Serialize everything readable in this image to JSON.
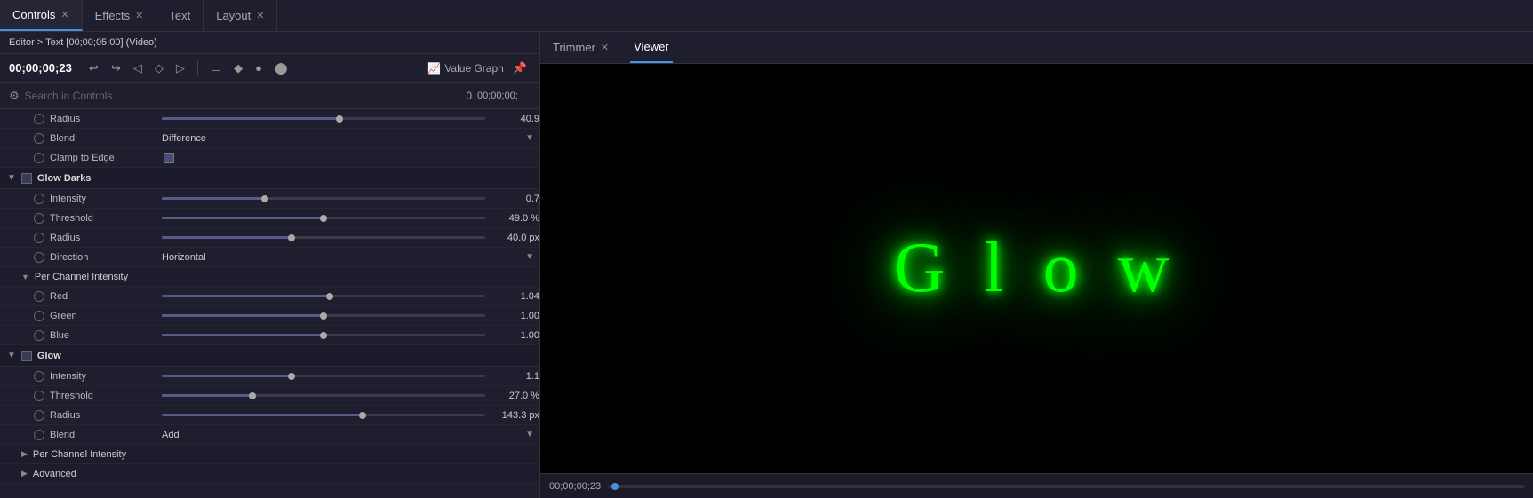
{
  "tabs": [
    {
      "id": "controls",
      "label": "Controls",
      "active": true,
      "closable": true
    },
    {
      "id": "effects",
      "label": "Effects",
      "active": false,
      "closable": true
    },
    {
      "id": "text",
      "label": "Text",
      "active": false,
      "closable": false
    },
    {
      "id": "layout",
      "label": "Layout",
      "active": false,
      "closable": true
    }
  ],
  "editor_path": "Editor > Text [00;00;05;00] (Video)",
  "time_display": "00;00;00;23",
  "toolbar": {
    "undo": "↩",
    "redo": "↪",
    "value_graph_label": "Value Graph"
  },
  "search_placeholder": "Search in Controls",
  "timeline_marker": "0",
  "timeline_time": "00;00;00;",
  "sections": {
    "glow_darks": {
      "title": "Glow Darks",
      "controls": [
        {
          "label": "Radius",
          "type": "slider",
          "value": "40.9",
          "fill_pct": 55
        },
        {
          "label": "Blend",
          "type": "dropdown",
          "value": "Difference"
        },
        {
          "label": "Clamp to Edge",
          "type": "checkbox",
          "value": ""
        }
      ],
      "subsections": [
        {
          "title": "Glow Darks",
          "controls": [
            {
              "label": "Intensity",
              "type": "slider",
              "value": "0.7",
              "fill_pct": 32,
              "thumb_pct": 32
            },
            {
              "label": "Threshold",
              "type": "slider",
              "value": "49.0 %",
              "fill_pct": 50,
              "thumb_pct": 50
            },
            {
              "label": "Radius",
              "type": "slider",
              "value": "40.0 px",
              "fill_pct": 40,
              "thumb_pct": 40
            },
            {
              "label": "Direction",
              "type": "dropdown",
              "value": "Horizontal"
            }
          ]
        },
        {
          "title": "Per Channel Intensity",
          "controls": [
            {
              "label": "Red",
              "type": "slider",
              "value": "1.04",
              "fill_pct": 52,
              "thumb_pct": 52
            },
            {
              "label": "Green",
              "type": "slider",
              "value": "1.00",
              "fill_pct": 50,
              "thumb_pct": 50
            },
            {
              "label": "Blue",
              "type": "slider",
              "value": "1.00",
              "fill_pct": 50,
              "thumb_pct": 50
            }
          ]
        }
      ]
    },
    "glow": {
      "title": "Glow",
      "controls": [
        {
          "label": "Intensity",
          "type": "slider",
          "value": "1.1",
          "fill_pct": 40,
          "thumb_pct": 40
        },
        {
          "label": "Threshold",
          "type": "slider",
          "value": "27.0 %",
          "fill_pct": 28,
          "thumb_pct": 28
        },
        {
          "label": "Radius",
          "type": "slider",
          "value": "143.3 px",
          "fill_pct": 62,
          "thumb_pct": 62
        },
        {
          "label": "Blend",
          "type": "dropdown",
          "value": "Add"
        }
      ],
      "subsections_below": [
        {
          "title": "Per Channel Intensity"
        },
        {
          "title": "Advanced"
        }
      ]
    }
  },
  "viewer": {
    "trimmer_tab": "Trimmer",
    "viewer_tab": "Viewer",
    "glow_text": "G l o w",
    "timeline_time": "00;00;00;23"
  }
}
